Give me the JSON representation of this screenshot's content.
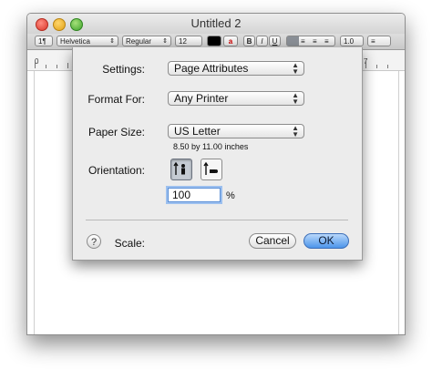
{
  "window": {
    "title": "Untitled 2"
  },
  "toolbar": {
    "paragraph_style": "1¶",
    "font_family": "Helvetica",
    "font_style": "Regular",
    "font_size": "12",
    "text_color": "#000000",
    "bold": "B",
    "italic": "I",
    "underline": "U",
    "line_spacing": "1.0",
    "list_style": "≡"
  },
  "ruler": {
    "start_label": "0",
    "end_label": "7"
  },
  "sheet": {
    "settings_label": "Settings:",
    "settings_value": "Page Attributes",
    "format_for_label": "Format For:",
    "format_for_value": "Any Printer",
    "paper_size_label": "Paper Size:",
    "paper_size_value": "US Letter",
    "paper_dimensions": "8.50 by 11.00 inches",
    "orientation_label": "Orientation:",
    "orientation_selected": "portrait",
    "scale_label": "Scale:",
    "scale_value": "100",
    "scale_unit": "%",
    "help_label": "?",
    "cancel_label": "Cancel",
    "ok_label": "OK"
  }
}
